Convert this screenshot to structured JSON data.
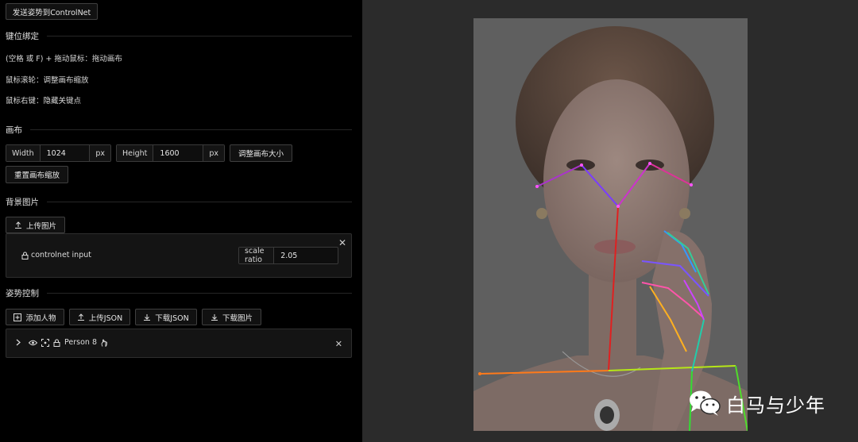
{
  "top_button": "发送姿势到ControlNet",
  "keybind": {
    "title": "键位绑定",
    "lines": [
      "(空格 或 F) + 拖动鼠标：拖动画布",
      "鼠标滚轮：调整画布缩放",
      "鼠标右键：隐藏关键点"
    ]
  },
  "canvas_section": {
    "title": "画布",
    "width_label": "Width",
    "width_value": "1024",
    "height_label": "Height",
    "height_value": "1600",
    "unit": "px",
    "resize_button": "调整画布大小",
    "reset_zoom_button": "重置画布缩放"
  },
  "background": {
    "title": "背景图片",
    "upload_button": "上传图片",
    "image_name": "controlnet input",
    "scale_label": "scale ratio",
    "scale_value": "2.05"
  },
  "pose": {
    "title": "姿势控制",
    "add_person": "添加人物",
    "upload_json": "上传JSON",
    "download_json": "下载JSON",
    "download_image": "下载图片",
    "person_name": "Person 8"
  },
  "watermark": "白马与少年",
  "colors": {
    "panel_bg": "#000000",
    "canvas_bg": "#2b2b2b",
    "border": "#3f3f3f"
  }
}
